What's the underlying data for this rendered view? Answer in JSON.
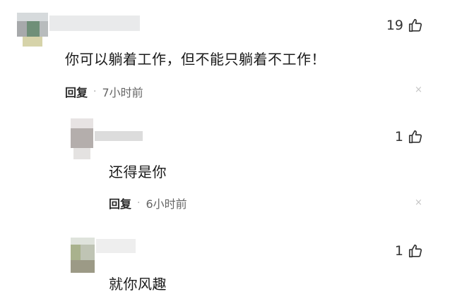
{
  "comments": [
    {
      "like_count": "19",
      "text": "你可以躺着工作，但不能只躺着不工作！",
      "reply_label": "回复",
      "separator": "·",
      "time": "7小时前",
      "close_symbol": "×"
    },
    {
      "like_count": "1",
      "text": "还得是你",
      "reply_label": "回复",
      "separator": "·",
      "time": "6小时前",
      "close_symbol": "×"
    },
    {
      "like_count": "1",
      "text": "就你风趣"
    }
  ],
  "icons": {
    "like": "thumbs-up-icon",
    "close": "close-icon"
  }
}
